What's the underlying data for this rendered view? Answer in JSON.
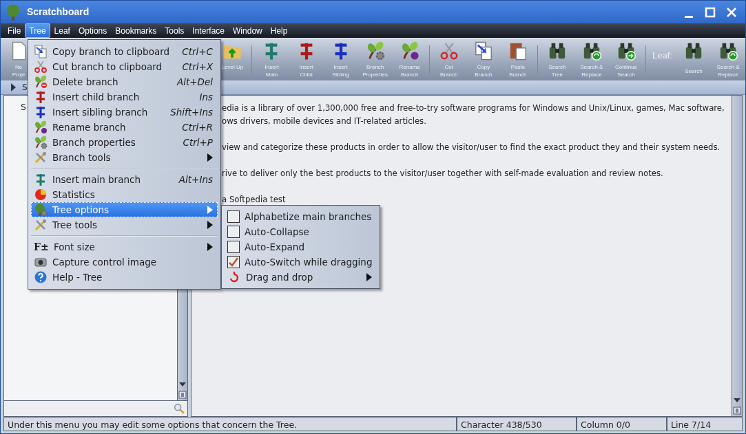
{
  "window": {
    "title": "Scratchboard"
  },
  "menu_bar": [
    {
      "label": "File",
      "selected": false
    },
    {
      "label": "Tree",
      "selected": true
    },
    {
      "label": "Leaf",
      "selected": false
    },
    {
      "label": "Options",
      "selected": false
    },
    {
      "label": "Bookmarks",
      "selected": false
    },
    {
      "label": "Tools",
      "selected": false
    },
    {
      "label": "Interface",
      "selected": false
    },
    {
      "label": "Window",
      "selected": false
    },
    {
      "label": "Help",
      "selected": false
    }
  ],
  "toolbar": [
    {
      "kind": "button",
      "label": "Ne Proje"
    },
    {
      "kind": "gap"
    },
    {
      "kind": "button",
      "label": "Level Up"
    },
    {
      "kind": "separator"
    },
    {
      "kind": "button",
      "label": "Insert Main"
    },
    {
      "kind": "button",
      "label": "Insert Child"
    },
    {
      "kind": "button",
      "label": "Insert Sibling"
    },
    {
      "kind": "button",
      "label": "Branch Properties"
    },
    {
      "kind": "button",
      "label": "Rename Branch"
    },
    {
      "kind": "separator"
    },
    {
      "kind": "button",
      "label": "Cut Branch"
    },
    {
      "kind": "button",
      "label": "Copy Branch"
    },
    {
      "kind": "button",
      "label": "Paste Branch"
    },
    {
      "kind": "separator"
    },
    {
      "kind": "button",
      "label": "Search Tree"
    },
    {
      "kind": "button",
      "label": "Search & Replace"
    },
    {
      "kind": "button",
      "label": "Continue Search"
    },
    {
      "kind": "separator"
    },
    {
      "kind": "label",
      "label": "Leaf:"
    },
    {
      "kind": "button",
      "label": "Search"
    },
    {
      "kind": "button",
      "label": "Search & Replace"
    }
  ],
  "path_bar": {
    "text": "S"
  },
  "tree": {
    "items": [
      {
        "label": "S"
      }
    ]
  },
  "content": {
    "paragraphs": [
      [
        "edia is a library of over 1,300,000 free and free-to-try software programs for Windows and Unix/Linux, games, Mac software,",
        "ows drivers, mobile devices and IT-related articles."
      ],
      [
        "view and categorize these products in order to allow the visitor/user to find the exact product they and their system needs."
      ],
      [
        "rive to deliver only the best products to the visitor/user together with self-made evaluation and review notes."
      ],
      [
        "a Softpedia test"
      ]
    ]
  },
  "tree_menu": [
    {
      "kind": "item",
      "label": "Copy branch to clipboard",
      "shortcut": "Ctrl+C",
      "has_submenu": false,
      "selected": false
    },
    {
      "kind": "item",
      "label": "Cut branch to clipboard",
      "shortcut": "Ctrl+X",
      "has_submenu": false,
      "selected": false
    },
    {
      "kind": "item",
      "label": "Delete branch",
      "shortcut": "Alt+Del",
      "has_submenu": false,
      "selected": false
    },
    {
      "kind": "item",
      "label": "Insert child branch",
      "shortcut": "Ins",
      "has_submenu": false,
      "selected": false
    },
    {
      "kind": "item",
      "label": "Insert sibling branch",
      "shortcut": "Shift+Ins",
      "has_submenu": false,
      "selected": false
    },
    {
      "kind": "item",
      "label": "Rename branch",
      "shortcut": "Ctrl+R",
      "has_submenu": false,
      "selected": false
    },
    {
      "kind": "item",
      "label": "Branch properties",
      "shortcut": "Ctrl+P",
      "has_submenu": false,
      "selected": false
    },
    {
      "kind": "item",
      "label": "Branch tools",
      "has_submenu": true,
      "selected": false
    },
    {
      "kind": "separator"
    },
    {
      "kind": "item",
      "label": "Insert main branch",
      "shortcut": "Alt+Ins",
      "has_submenu": false,
      "selected": false
    },
    {
      "kind": "item",
      "label": "Statistics",
      "has_submenu": false,
      "selected": false
    },
    {
      "kind": "item",
      "label": "Tree options",
      "has_submenu": true,
      "selected": true
    },
    {
      "kind": "item",
      "label": "Tree tools",
      "has_submenu": true,
      "selected": false
    },
    {
      "kind": "separator"
    },
    {
      "kind": "item",
      "label": "Font size",
      "icon_text": "F±",
      "has_submenu": true,
      "selected": false
    },
    {
      "kind": "item",
      "label": "Capture control image",
      "has_submenu": false,
      "selected": false
    },
    {
      "kind": "item",
      "label": "Help - Tree",
      "has_submenu": false,
      "selected": false
    }
  ],
  "tree_options_menu": [
    {
      "kind": "checkbox",
      "label": "Alphabetize main branches",
      "checked": false
    },
    {
      "kind": "checkbox",
      "label": "Auto-Collapse",
      "checked": false
    },
    {
      "kind": "checkbox",
      "label": "Auto-Expand",
      "checked": false
    },
    {
      "kind": "checkbox",
      "label": "Auto-Switch while dragging",
      "checked": true
    },
    {
      "kind": "submenu",
      "label": "Drag and drop"
    }
  ],
  "status_bar": [
    "Under this menu you may edit some options that concern the Tree.",
    "Character 438/530",
    "Column 0/0",
    "Line 7/14"
  ]
}
